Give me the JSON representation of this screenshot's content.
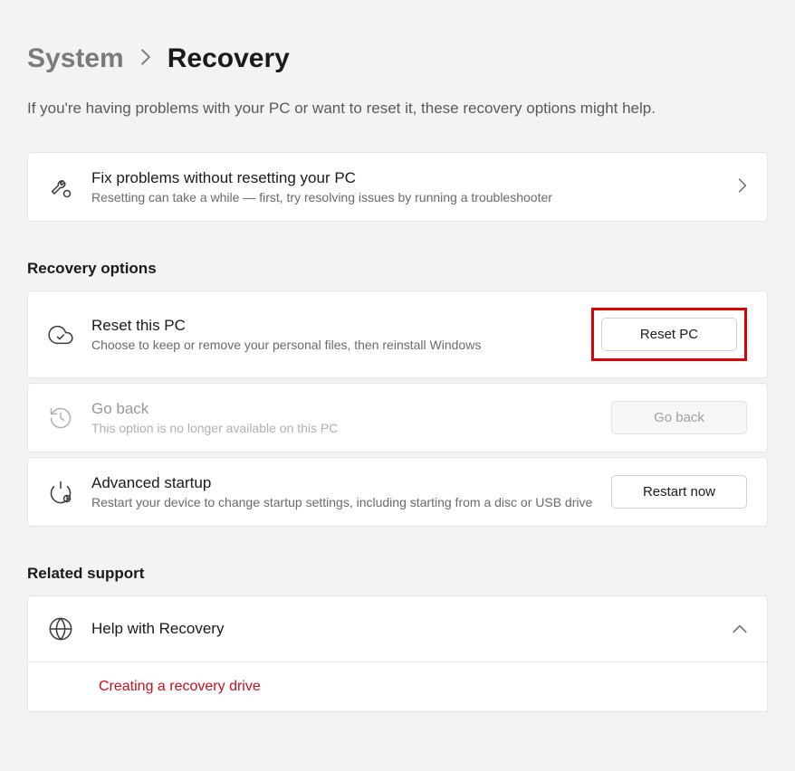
{
  "breadcrumb": {
    "parent": "System",
    "current": "Recovery"
  },
  "description": "If you're having problems with your PC or want to reset it, these recovery options might help.",
  "fix_card": {
    "title": "Fix problems without resetting your PC",
    "subtitle": "Resetting can take a while — first, try resolving issues by running a troubleshooter"
  },
  "section_recovery": "Recovery options",
  "reset_card": {
    "title": "Reset this PC",
    "subtitle": "Choose to keep or remove your personal files, then reinstall Windows",
    "button": "Reset PC"
  },
  "goback_card": {
    "title": "Go back",
    "subtitle": "This option is no longer available on this PC",
    "button": "Go back"
  },
  "advanced_card": {
    "title": "Advanced startup",
    "subtitle": "Restart your device to change startup settings, including starting from a disc or USB drive",
    "button": "Restart now"
  },
  "section_related": "Related support",
  "help_card": {
    "title": "Help with Recovery",
    "link": "Creating a recovery drive"
  }
}
